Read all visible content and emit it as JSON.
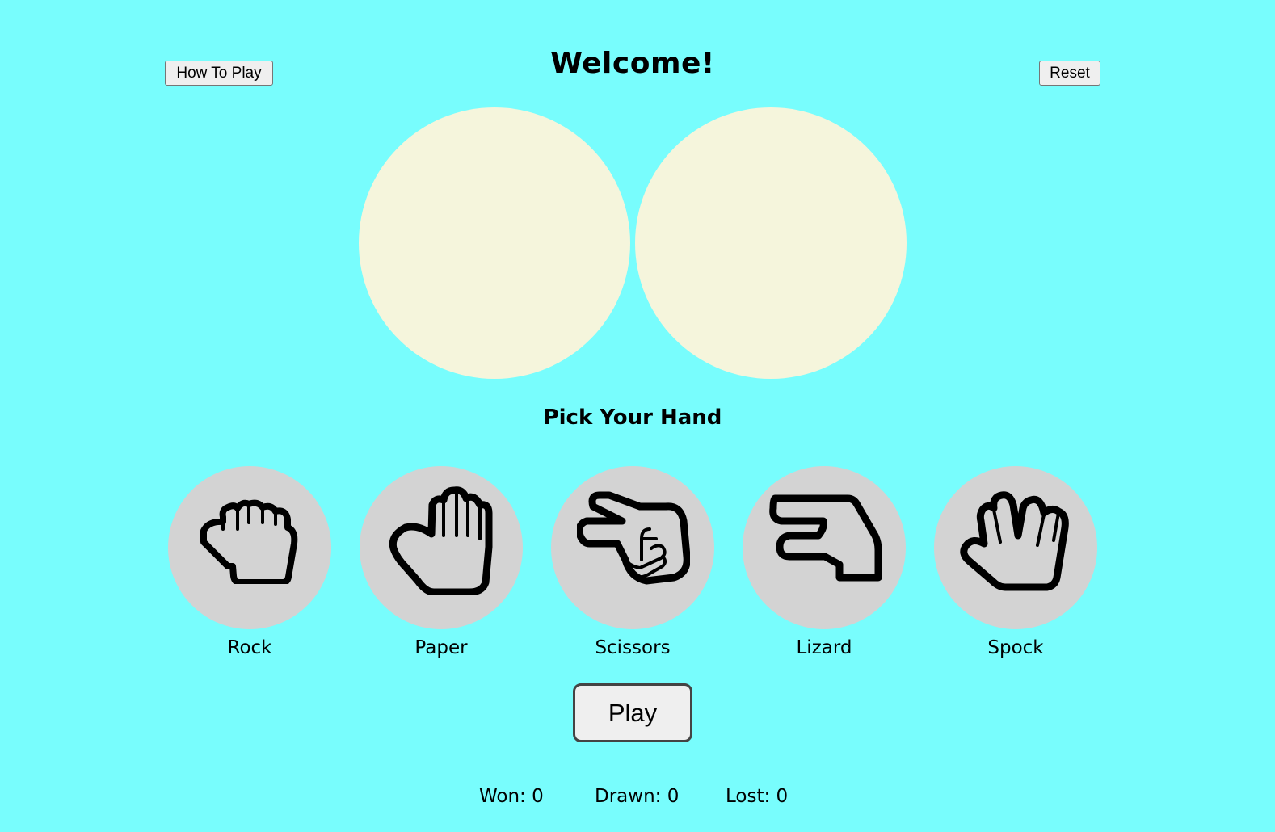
{
  "header": {
    "how_to_play_label": "How To Play",
    "title": "Welcome!",
    "reset_label": "Reset"
  },
  "arena": {
    "player_hand": "",
    "computer_hand": ""
  },
  "picker": {
    "heading": "Pick Your Hand",
    "hands": [
      {
        "label": "Rock",
        "icon": "rock-hand-icon"
      },
      {
        "label": "Paper",
        "icon": "paper-hand-icon"
      },
      {
        "label": "Scissors",
        "icon": "scissors-hand-icon"
      },
      {
        "label": "Lizard",
        "icon": "lizard-hand-icon"
      },
      {
        "label": "Spock",
        "icon": "spock-hand-icon"
      }
    ]
  },
  "play_label": "Play",
  "scoreboard": {
    "won": "Won: 0",
    "drawn": "Drawn: 0",
    "lost": "Lost: 0"
  },
  "colors": {
    "background": "#78fdfd",
    "result_circle": "#f5f5dc",
    "hand_circle": "#d3d3d3"
  }
}
